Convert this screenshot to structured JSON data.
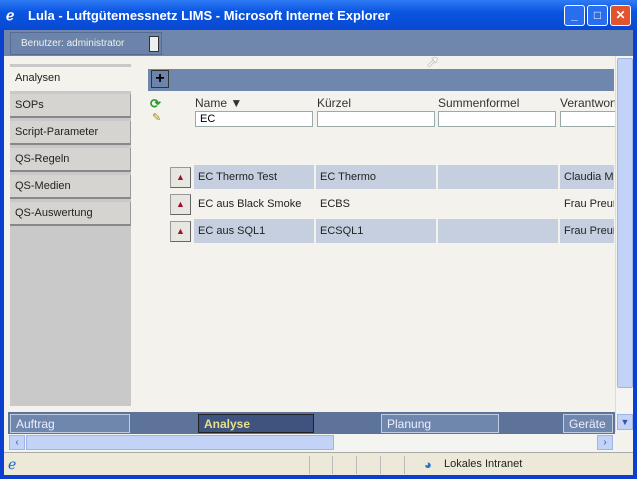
{
  "window": {
    "title": "Lula - Luftgütemessnetz LIMS - Microsoft Internet Explorer",
    "buttons": [
      "_",
      "□",
      "✕"
    ]
  },
  "user": {
    "label": "Benutzer: administrator"
  },
  "sidebar": {
    "items": [
      {
        "label": "Analysen"
      },
      {
        "label": "SOPs"
      },
      {
        "label": "Script-Parameter"
      },
      {
        "label": "QS-Regeln"
      },
      {
        "label": "QS-Medien"
      },
      {
        "label": "QS-Auswertung"
      }
    ]
  },
  "table": {
    "columns": [
      {
        "label": "Name ▼",
        "filter": "EC"
      },
      {
        "label": "Kürzel",
        "filter": ""
      },
      {
        "label": "Summenformel",
        "filter": ""
      },
      {
        "label": "Verantwort",
        "filter": ""
      }
    ],
    "rows": [
      {
        "name": "EC Thermo Test",
        "kuerzel": "EC Thermo",
        "formel": "",
        "verantwortlich": "Claudia Mu"
      },
      {
        "name": "EC aus Black Smoke",
        "kuerzel": "ECBS",
        "formel": "",
        "verantwortlich": "Frau Preuß"
      },
      {
        "name": "EC aus SQL1",
        "kuerzel": "ECSQL1",
        "formel": "",
        "verantwortlich": "Frau Preuß"
      }
    ]
  },
  "bottom_tabs": [
    {
      "label": "Auftrag"
    },
    {
      "label": "Analyse"
    },
    {
      "label": "Planung"
    },
    {
      "label": "Geräte"
    }
  ],
  "status": {
    "zone": "Lokales Intranet"
  }
}
